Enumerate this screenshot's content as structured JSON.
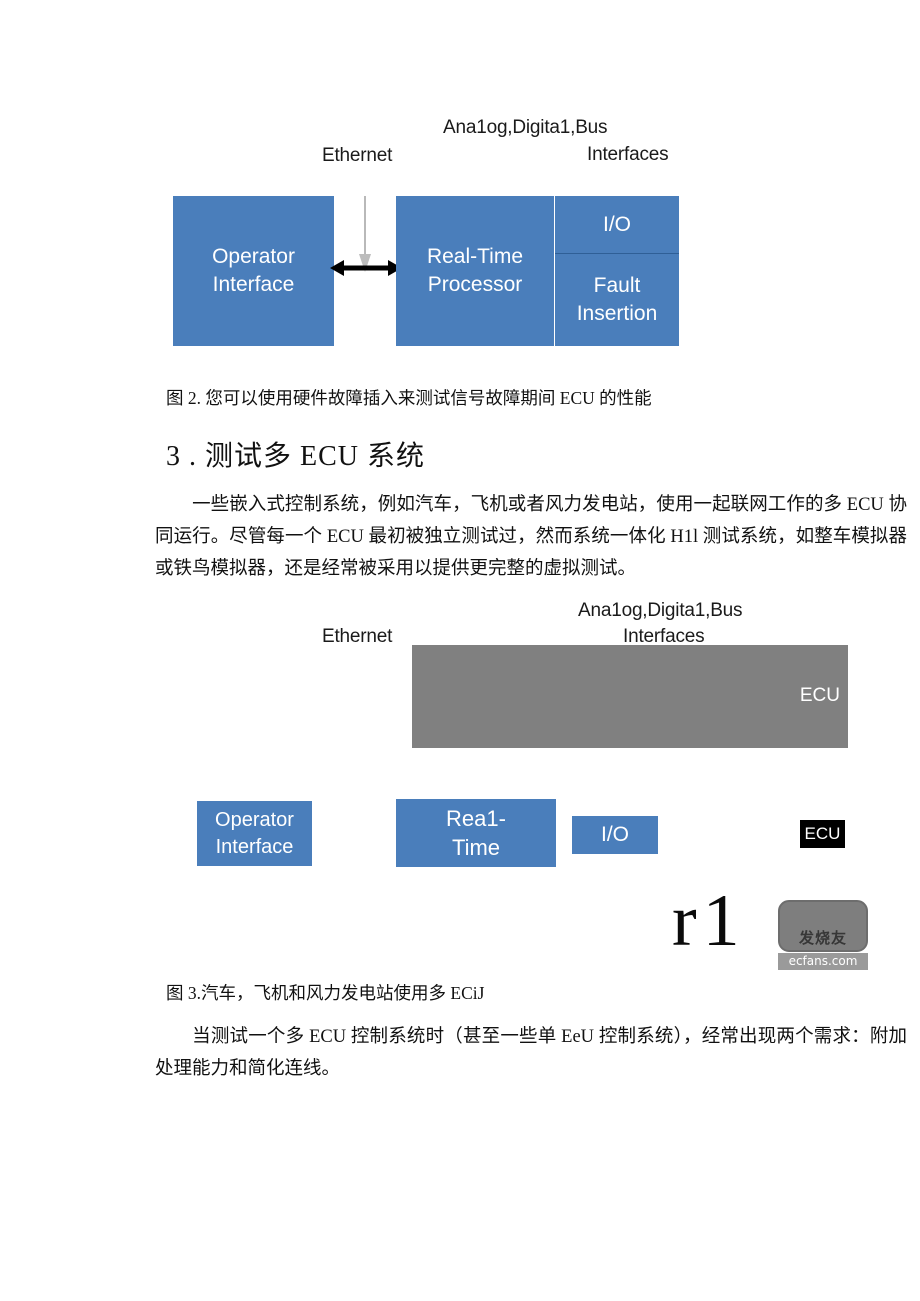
{
  "figure2": {
    "labels": {
      "ethernet": "Ethernet",
      "interfaces_line1": "Ana1og,Digita1,Bus",
      "interfaces_line2": "Interfaces"
    },
    "boxes": {
      "operator_line1": "Operator",
      "operator_line2": "Interface",
      "rtp_line1": "Real-Time",
      "rtp_line2": "Processor",
      "io": "I/O",
      "fault_line1": "Fault",
      "fault_line2": "Insertion"
    },
    "colors": {
      "box_blue": "#4a7ebb",
      "box_text": "#ffffff",
      "arrow_black": "#000000",
      "arrow_gray": "#b6b6b6"
    },
    "caption": "图 2. 您可以使用硬件故障插入来测试信号故障期间 ECU 的性能"
  },
  "section": {
    "heading": "3 . 测试多 ECU 系统",
    "paragraph": "一些嵌入式控制系统，例如汽车，飞机或者风力发电站，使用一起联网工作的多 ECU 协同运行。尽管每一个 ECU 最初被独立测试过，然而系统一体化 H1l 测试系统，如整车模拟器或铁鸟模拟器，还是经常被采用以提供更完整的虚拟测试。"
  },
  "figure3": {
    "labels": {
      "ethernet": "Ethernet",
      "interfaces_line1": "Ana1og,Digita1,Bus",
      "interfaces_line2": "Interfaces"
    },
    "gray_bar": {
      "label": "ECU",
      "color": "#808080"
    },
    "boxes": {
      "operator_line1": "Operator",
      "operator_line2": "Interface",
      "rt_line1": "Rea1-",
      "rt_line2": "Time",
      "io": "I/O",
      "ecu_chip": "ECU"
    },
    "artifact": "r1",
    "watermark": {
      "mark_text": "发烧友",
      "url": "ecfans.com"
    },
    "caption": "图 3.汽车，飞机和风力发电站使用多 ECiJ"
  },
  "closing": {
    "paragraph": "当测试一个多 ECU 控制系统时（甚至一些单 EeU 控制系统），经常出现两个需求：附加处理能力和简化连线。"
  }
}
